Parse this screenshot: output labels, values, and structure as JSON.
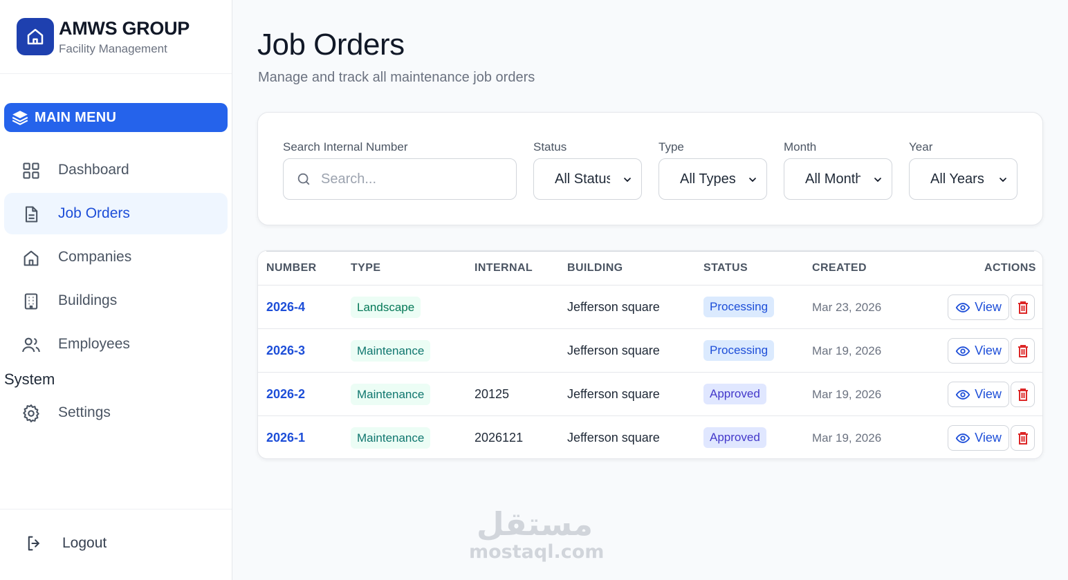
{
  "brand": {
    "name": "AMWS GROUP",
    "subtitle": "Facility Management"
  },
  "sidebar": {
    "menu_title": "MAIN MENU",
    "items": [
      {
        "label": "Dashboard",
        "icon": "grid-icon"
      },
      {
        "label": "Job Orders",
        "icon": "document-icon",
        "active": true
      },
      {
        "label": "Companies",
        "icon": "home-icon"
      },
      {
        "label": "Buildings",
        "icon": "building-icon"
      },
      {
        "label": "Employees",
        "icon": "users-icon"
      }
    ],
    "system_label": "System",
    "system_items": [
      {
        "label": "Settings",
        "icon": "gear-icon"
      }
    ],
    "logout_label": "Logout"
  },
  "header": {
    "title": "Job Orders",
    "subtitle": "Manage and track all maintenance job orders"
  },
  "filters": {
    "search_label": "Search Internal Number",
    "search_placeholder": "Search...",
    "status_label": "Status",
    "status_value": "All Status",
    "type_label": "Type",
    "type_value": "All Types",
    "month_label": "Month",
    "month_value": "All Months",
    "year_label": "Year",
    "year_value": "All Years"
  },
  "table": {
    "columns": [
      "NUMBER",
      "TYPE",
      "INTERNAL",
      "BUILDING",
      "STATUS",
      "CREATED",
      "ACTIONS"
    ],
    "view_label": "View",
    "rows": [
      {
        "number": "2026-4",
        "type": "Landscape",
        "internal": "",
        "building": "Jefferson square",
        "status": "Processing",
        "created": "Mar 23, 2026"
      },
      {
        "number": "2026-3",
        "type": "Maintenance",
        "internal": "",
        "building": "Jefferson square",
        "status": "Processing",
        "created": "Mar 19, 2026"
      },
      {
        "number": "2026-2",
        "type": "Maintenance",
        "internal": "20125",
        "building": "Jefferson square",
        "status": "Approved",
        "created": "Mar 19, 2026"
      },
      {
        "number": "2026-1",
        "type": "Maintenance",
        "internal": "2026121",
        "building": "Jefferson square",
        "status": "Approved",
        "created": "Mar 19, 2026"
      }
    ]
  },
  "watermark": {
    "arabic": "مستقل",
    "latin": "mostaql.com"
  },
  "colors": {
    "accent": "#2563eb",
    "brand": "#1e40af",
    "danger": "#dc2626"
  }
}
